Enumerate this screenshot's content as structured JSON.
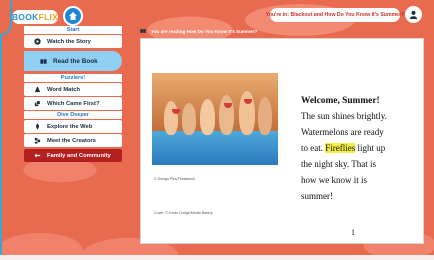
{
  "header": {
    "logo_part1": "BOOK",
    "logo_part2": "FLIX",
    "banner_text": "You're in: Blackout and How Do You Know It's Summer?"
  },
  "sidebar": {
    "sections": [
      {
        "title": "Start"
      },
      {
        "title": "Puzzlers!"
      },
      {
        "title": "Dive Deeper"
      }
    ],
    "items": [
      {
        "label": "Watch the Story",
        "icon": "play-icon"
      },
      {
        "label": "Read the Book",
        "icon": "book-icon",
        "active": true
      },
      {
        "label": "Word Match",
        "icon": "word-match-icon"
      },
      {
        "label": "Which Came First?",
        "icon": "order-icon"
      },
      {
        "label": "Explore the Web",
        "icon": "globe-icon"
      },
      {
        "label": "Meet the Creators",
        "icon": "creators-icon"
      },
      {
        "label": "Family and Community",
        "icon": "arrow-icon"
      }
    ]
  },
  "reading_line": "You are reading How Do You Know It's Summer?",
  "book": {
    "photo_credit": "© Design Pics/Thinkstock",
    "cover_credit": "Cover: © Kevin Dodge/Media Bakery",
    "title": "Welcome, Summer!",
    "lines": [
      "The sun shines brightly.",
      "Watermelons are ready",
      "to eat.",
      "Fireflies",
      "light up",
      "the night sky. That is",
      "how we know it is",
      "summer!"
    ],
    "page_number": "1"
  },
  "colors": {
    "background": "#e86b4f",
    "accent_blue": "#1e88d6",
    "active_item": "#8fd0f4",
    "community_button": "#b41f1f",
    "highlight": "#f7ef43"
  }
}
